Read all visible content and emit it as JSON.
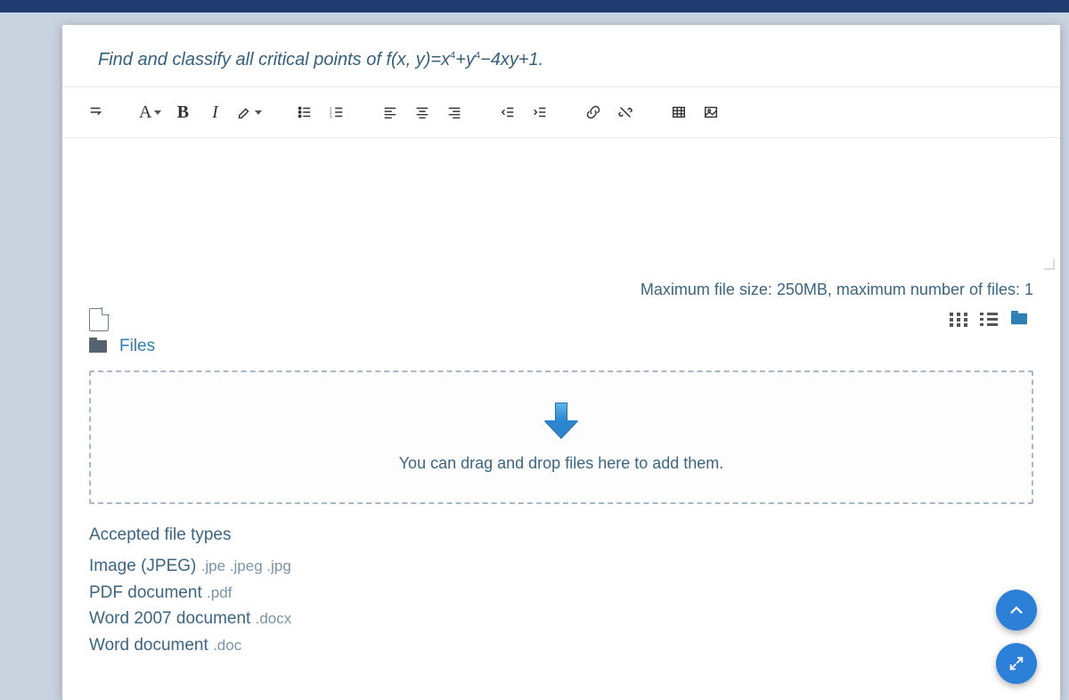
{
  "question": {
    "prefix": "Find and classify all critical points of ",
    "func": "f(x, y)=x",
    "exp1": "4",
    "mid1": "+y",
    "exp2": "4",
    "tail": "−4xy+1."
  },
  "toolbar": {
    "paragraph_icon": "↴",
    "font_color": "A",
    "bold": "B",
    "italic": "I",
    "highlight": "✎",
    "ul": "≔",
    "ol": "≔",
    "align_left": "≡",
    "align_center": "≡",
    "align_right": "≡",
    "outdent": "⇤",
    "indent": "⇥",
    "link": "🔗",
    "unlink": "✂",
    "table": "⊞",
    "image": "🖼"
  },
  "limits": {
    "text": "Maximum file size: 250MB, maximum number of files: 1"
  },
  "files": {
    "label": "Files"
  },
  "drop": {
    "text": "You can drag and drop files here to add them."
  },
  "accepted": {
    "title": "Accepted file types",
    "items": [
      {
        "name": "Image (JPEG)",
        "ext": ".jpe .jpeg .jpg"
      },
      {
        "name": "PDF document",
        "ext": ".pdf"
      },
      {
        "name": "Word 2007 document",
        "ext": ".docx"
      },
      {
        "name": "Word document",
        "ext": ".doc"
      }
    ]
  }
}
